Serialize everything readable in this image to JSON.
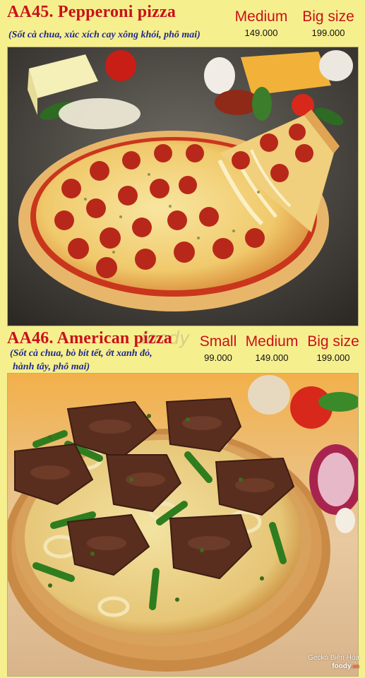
{
  "items": [
    {
      "title": "AA45. Pepperoni pizza",
      "description": "(Sốt cà chua, xúc xích cay xông khói, phô mai)",
      "sizes": [
        {
          "label": "Medium",
          "price": "149.000"
        },
        {
          "label": "Big size",
          "price": "199.000"
        }
      ]
    },
    {
      "title": "AA46. American pizza",
      "description_line1": "(Sốt cà chua, bò bít tết, ớt xanh đỏ,",
      "description_line2": "hành tây, phô mai)",
      "sizes": [
        {
          "label": "Small",
          "price": "99.000"
        },
        {
          "label": "Medium",
          "price": "149.000"
        },
        {
          "label": "Big size",
          "price": "199.000"
        }
      ]
    }
  ],
  "watermarks": {
    "center": "foody",
    "corner_line1": "Gecko Biên Hòa",
    "corner_brand": "foody",
    "corner_tld": ".vn"
  },
  "colors": {
    "background": "#f6ef8e",
    "title": "#c8121a",
    "description": "#1f2a8a",
    "price": "#111111"
  }
}
